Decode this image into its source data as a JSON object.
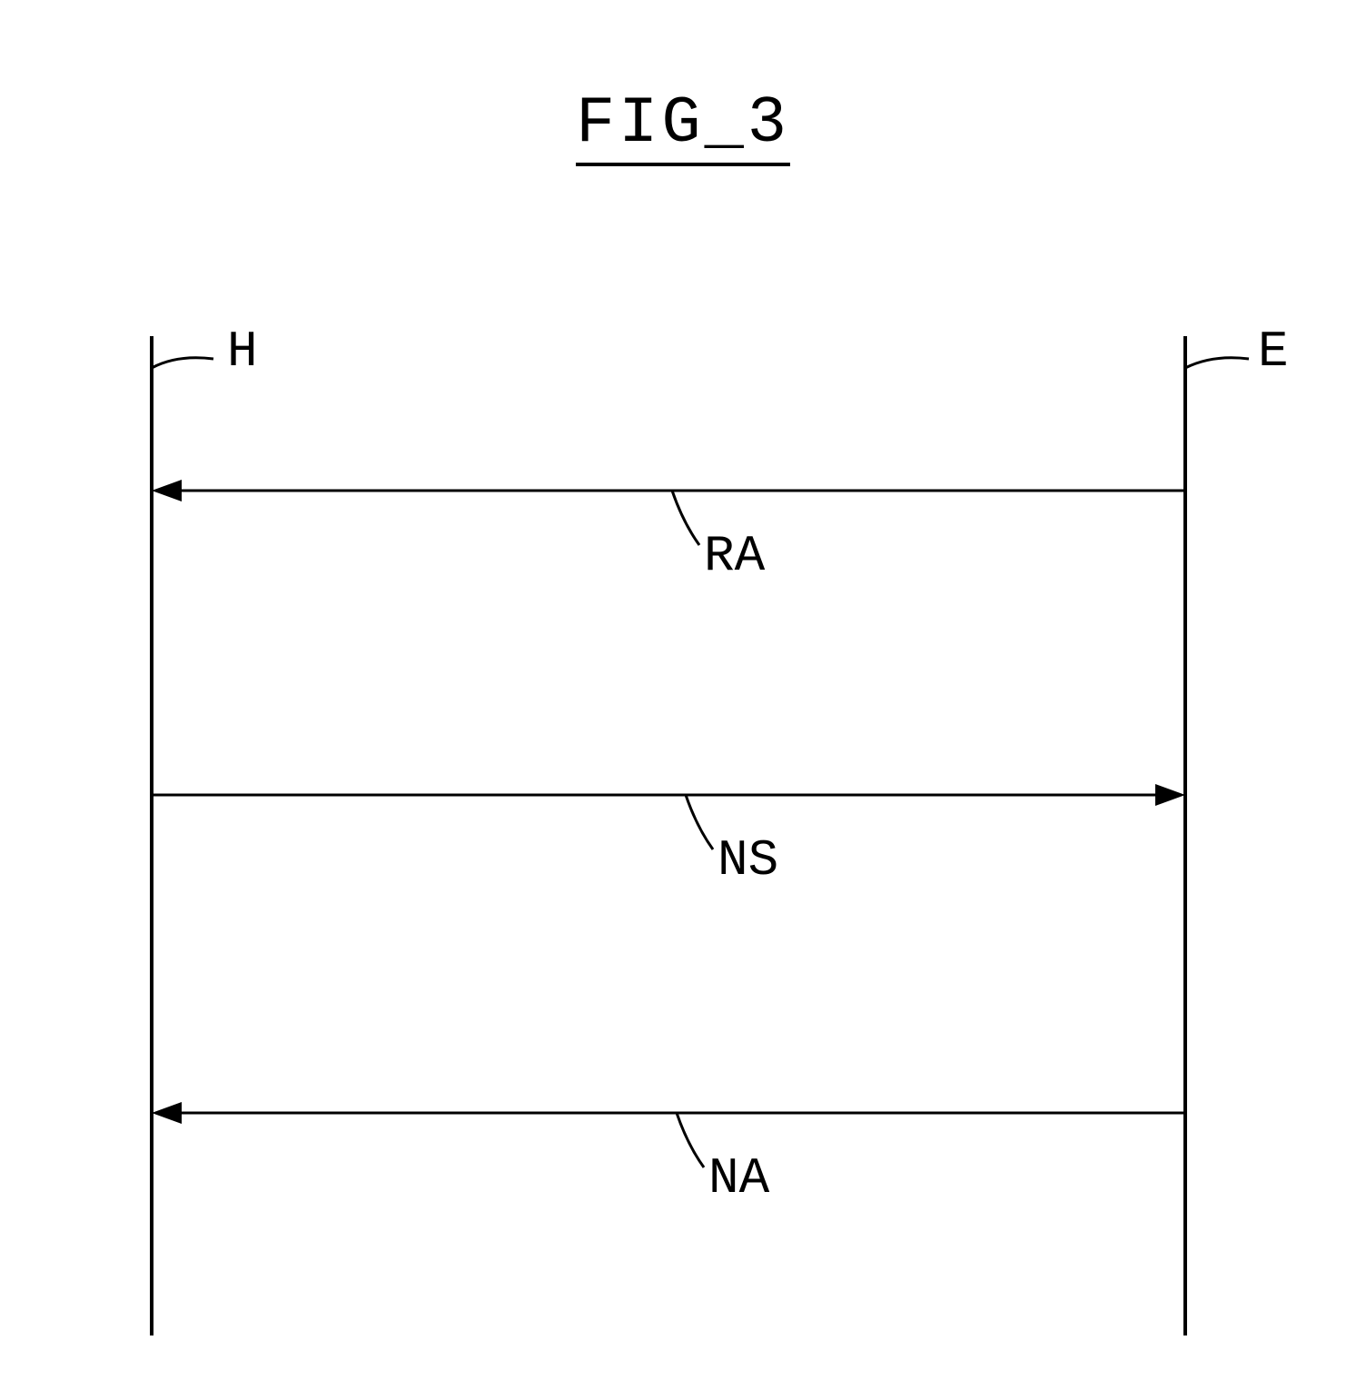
{
  "title": "FIG_3",
  "lifelines": {
    "left": "H",
    "right": "E"
  },
  "messages": [
    {
      "name": "RA",
      "direction": "left"
    },
    {
      "name": "NS",
      "direction": "right"
    },
    {
      "name": "NA",
      "direction": "left"
    }
  ],
  "chart_data": {
    "type": "sequence-diagram",
    "participants": [
      "H",
      "E"
    ],
    "messages": [
      {
        "from": "E",
        "to": "H",
        "label": "RA"
      },
      {
        "from": "H",
        "to": "E",
        "label": "NS"
      },
      {
        "from": "E",
        "to": "H",
        "label": "NA"
      }
    ]
  }
}
